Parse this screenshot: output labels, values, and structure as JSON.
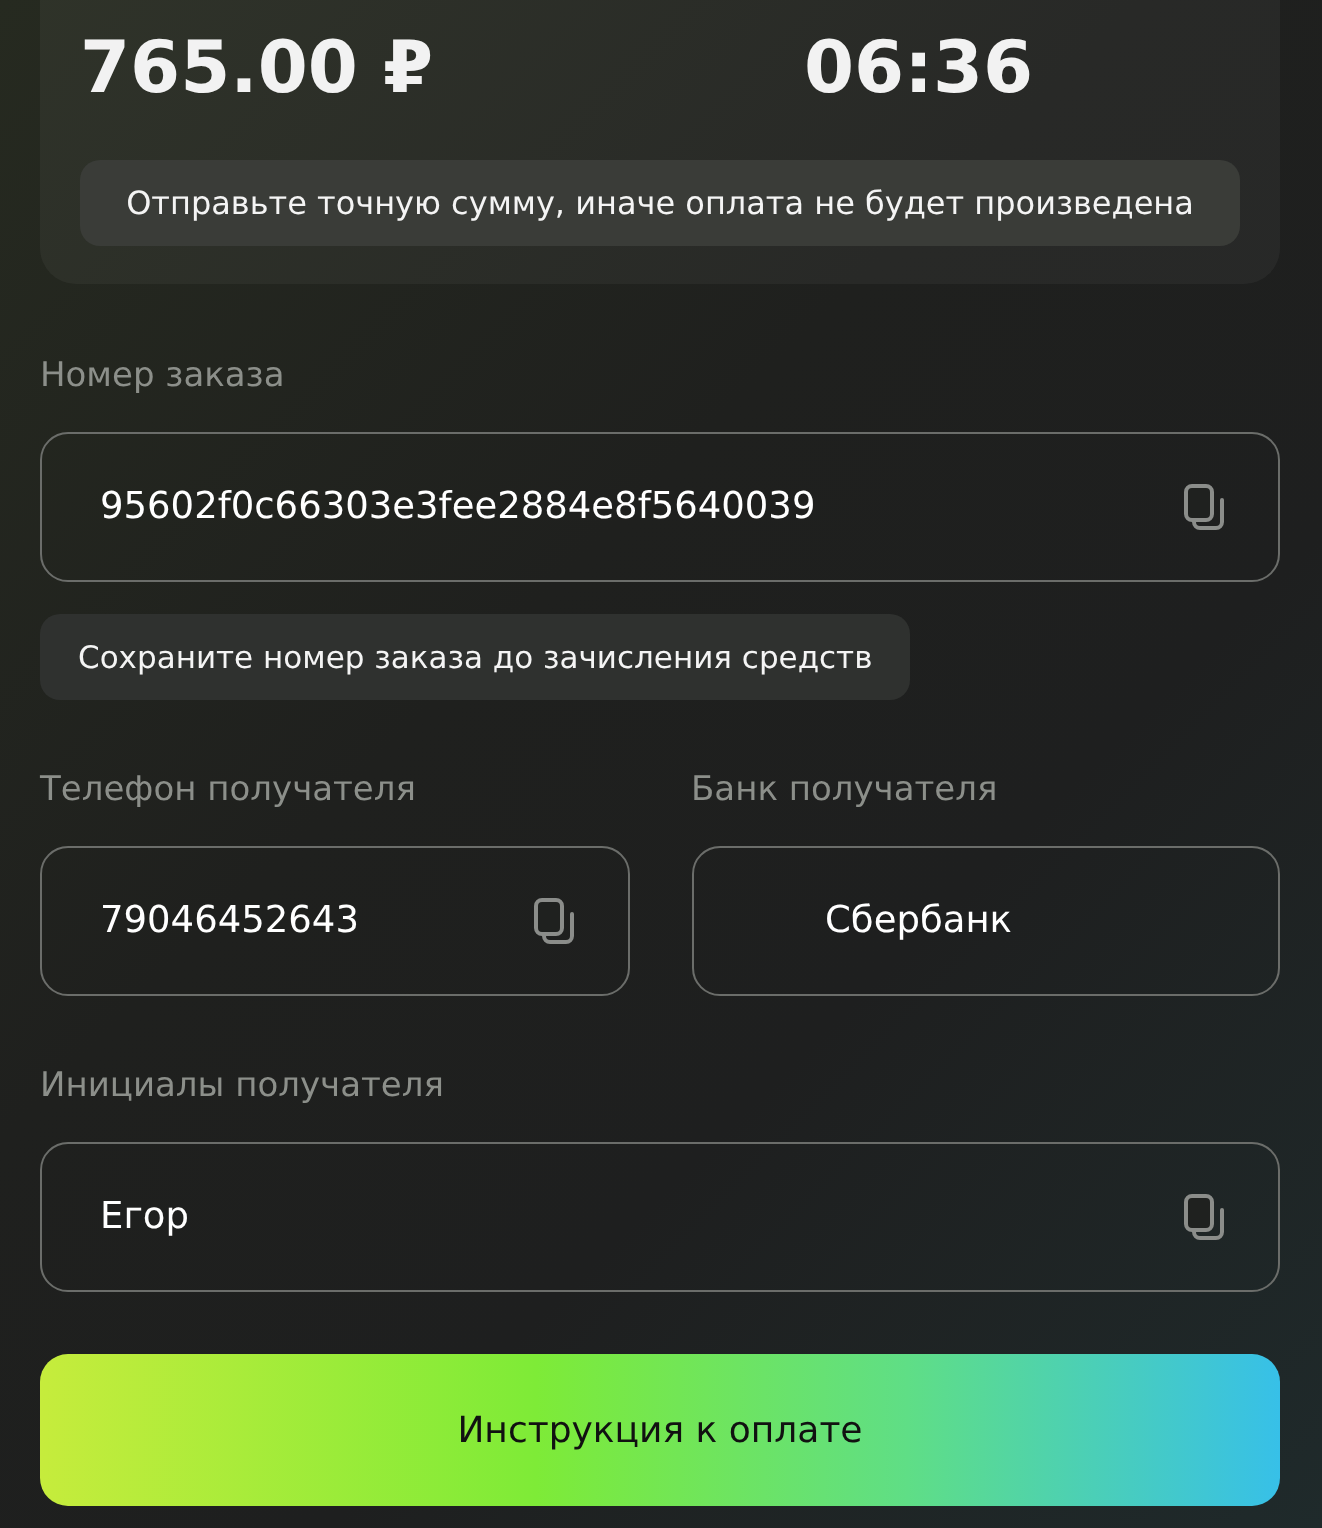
{
  "summary": {
    "amount": "765.00 ₽",
    "timer": "06:36",
    "notice": "Отправьте точную сумму, иначе оплата не будет произведена"
  },
  "rows": [
    [
      {
        "kind": "plain",
        "label": "Номер заказа",
        "value": "95602f0c66303e3fee2884e8f5640039",
        "copyable": true,
        "hint": "Сохраните номер заказа до зачисления средств"
      }
    ],
    [
      {
        "kind": "plain",
        "label": "Телефон получателя",
        "value": "79046452643",
        "copyable": true
      },
      {
        "kind": "bank",
        "label": "Банк получателя",
        "value": "Сбербанк",
        "copyable": false
      }
    ],
    [
      {
        "kind": "plain",
        "label": "Инициалы получателя",
        "value": "Егор",
        "copyable": true
      }
    ]
  ],
  "button": {
    "label": "Инструкция к оплате"
  }
}
